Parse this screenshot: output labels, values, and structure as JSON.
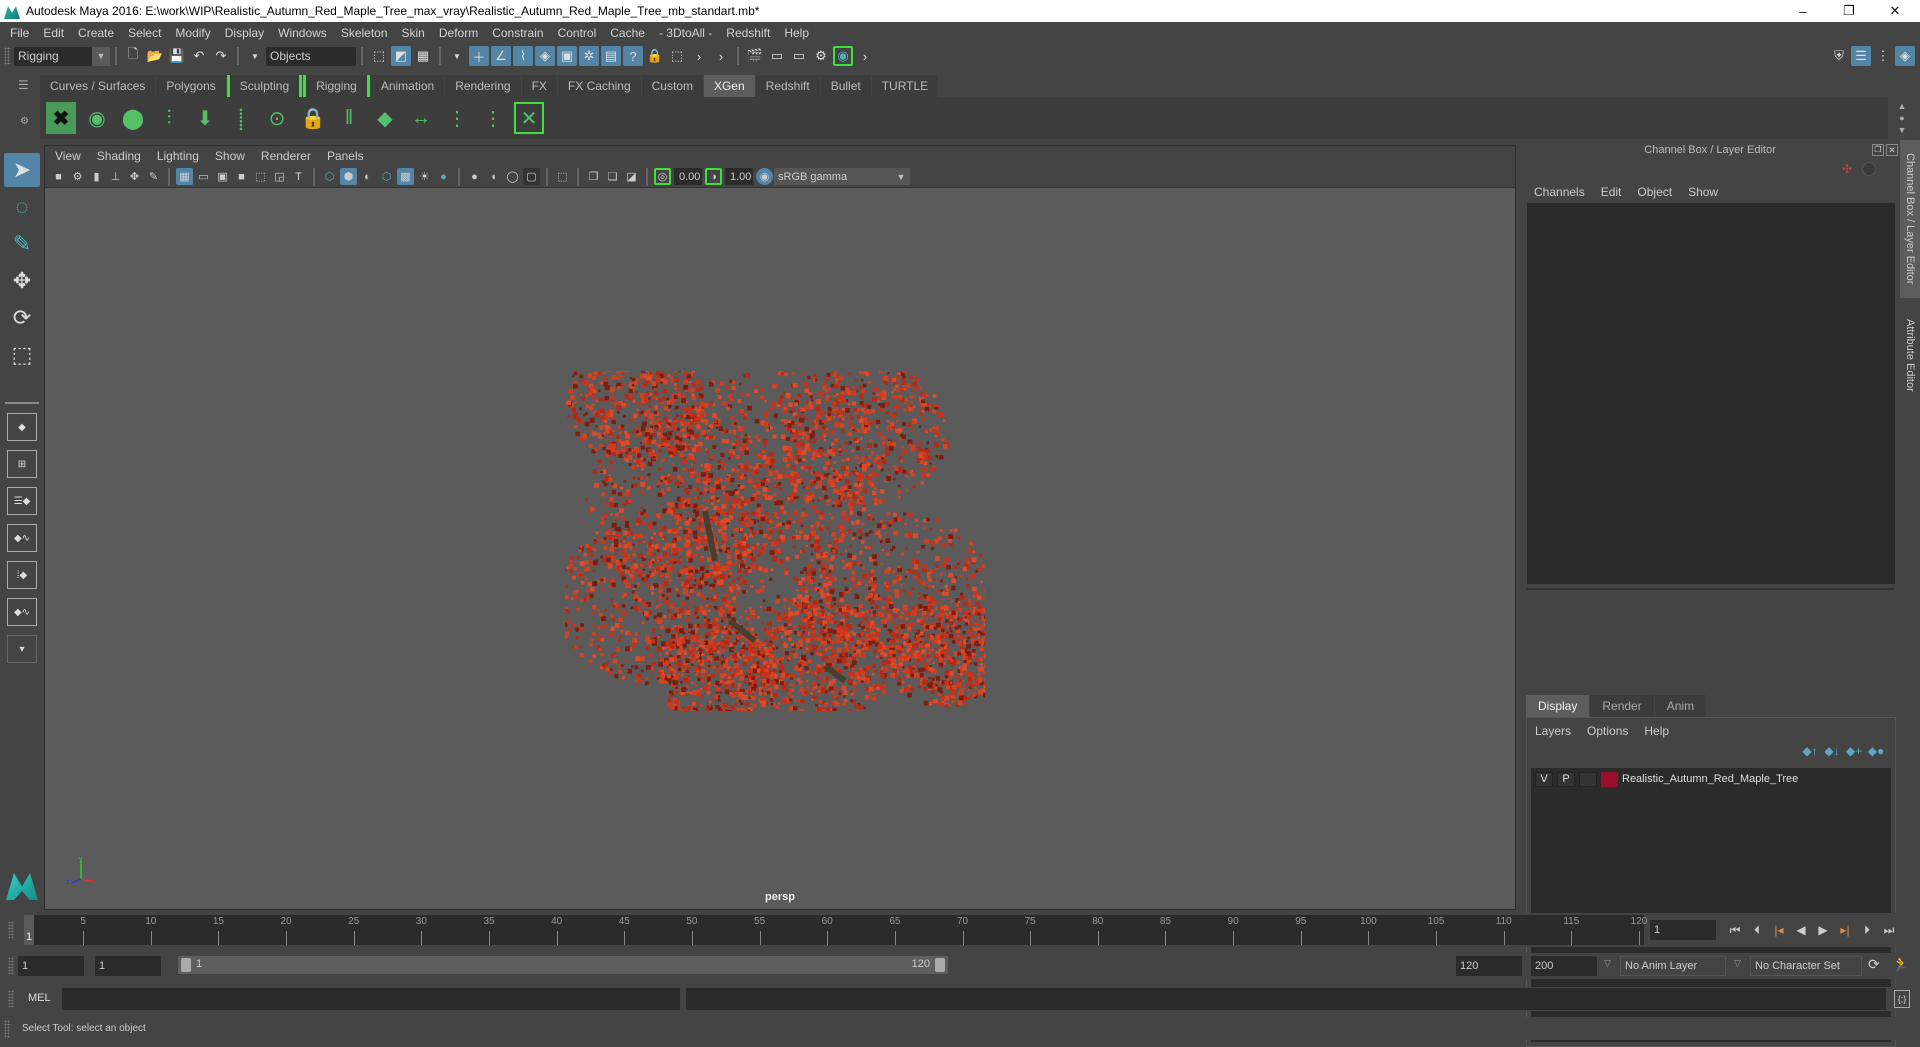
{
  "window": {
    "title": "Autodesk Maya 2016: E:\\work\\WIP\\Realistic_Autumn_Red_Maple_Tree_max_vray\\Realistic_Autumn_Red_Maple_Tree_mb_standart.mb*",
    "minimize": "–",
    "restore": "❐",
    "close": "✕"
  },
  "menubar": [
    "File",
    "Edit",
    "Create",
    "Select",
    "Modify",
    "Display",
    "Windows",
    "Skeleton",
    "Skin",
    "Deform",
    "Constrain",
    "Control",
    "Cache",
    "- 3DtoAll -",
    "Redshift",
    "Help"
  ],
  "statusline": {
    "mode": "Rigging",
    "selection_mask": "Objects"
  },
  "shelf": {
    "tabs": [
      {
        "label": "Curves / Surfaces"
      },
      {
        "label": "Polygons"
      },
      {
        "label": "Sculpting",
        "bracket": true
      },
      {
        "label": "Rigging",
        "bracket": true
      },
      {
        "label": "Animation"
      },
      {
        "label": "Rendering"
      },
      {
        "label": "FX"
      },
      {
        "label": "FX Caching"
      },
      {
        "label": "Custom"
      },
      {
        "label": "XGen",
        "active": true
      },
      {
        "label": "Redshift"
      },
      {
        "label": "Bullet"
      },
      {
        "label": "TURTLE"
      }
    ],
    "icons": [
      "xgen-window-icon",
      "xgen-preview-icon",
      "xgen-clear-preview-icon",
      "add-guides-icon",
      "place-guides-icon",
      "add-guide-icon",
      "toggle-guide-visibility-icon",
      "lock-guide-icon",
      "split-guide-icon",
      "guide-grid-icon",
      "guide-spacing-icon",
      "select-guide-icon",
      "guide-frame-icon",
      "delete-guide-icon"
    ]
  },
  "viewport": {
    "menu": [
      "View",
      "Shading",
      "Lighting",
      "Show",
      "Renderer",
      "Panels"
    ],
    "exposure": "0.00",
    "gamma": "1.00",
    "color_space": "sRGB gamma",
    "camera_label": "persp",
    "object_color": "#d63a1e"
  },
  "channel_box": {
    "title": "Channel Box / Layer Editor",
    "menu": [
      "Channels",
      "Edit",
      "Object",
      "Show"
    ]
  },
  "layer_editor": {
    "tabs": [
      {
        "label": "Display",
        "active": true
      },
      {
        "label": "Render"
      },
      {
        "label": "Anim"
      }
    ],
    "menu": [
      "Layers",
      "Options",
      "Help"
    ],
    "layers": [
      {
        "v": "V",
        "p": "P",
        "name": "Realistic_Autumn_Red_Maple_Tree",
        "color": "#9b0f2e"
      }
    ]
  },
  "side_tabs": [
    "Channel Box / Layer Editor",
    "Attribute Editor"
  ],
  "timeline": {
    "start": 1,
    "end": 120,
    "current_frame": "1",
    "current_frame_field": "1",
    "ticks": [
      5,
      10,
      15,
      20,
      25,
      30,
      35,
      40,
      45,
      50,
      55,
      60,
      65,
      70,
      75,
      80,
      85,
      90,
      95,
      100,
      105,
      110,
      115,
      120
    ]
  },
  "range": {
    "start_field": "1",
    "playback_start": "1",
    "slider_start": "1",
    "slider_end": "120",
    "playback_end": "120",
    "anim_end": "200",
    "anim_layer": "No Anim Layer",
    "character_set": "No Character Set"
  },
  "command_line": {
    "language": "MEL",
    "value": "",
    "result": ""
  },
  "help_line": "Select Tool: select an object"
}
